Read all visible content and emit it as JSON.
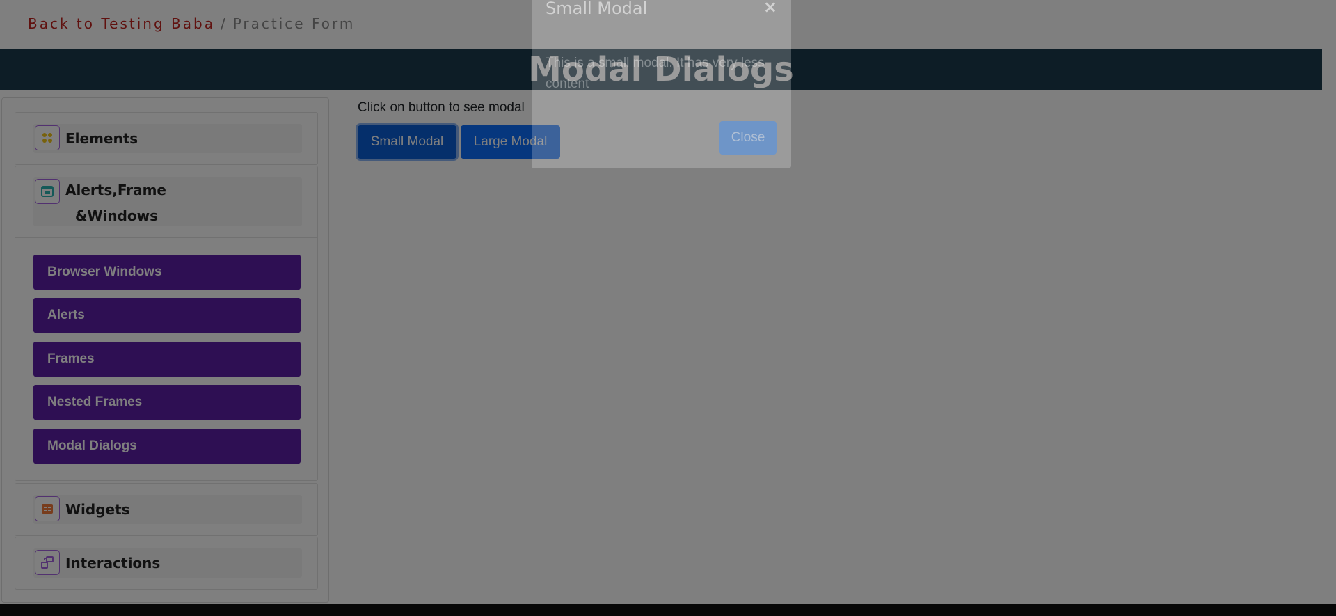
{
  "breadcrumb": {
    "link": "Back to Testing Baba",
    "separator": "/",
    "current": "Practice Form"
  },
  "banner": {
    "title": "Modal Dialogs"
  },
  "sidebar": {
    "groups": [
      {
        "label": "Elements",
        "icon": "grid-dots-icon"
      },
      {
        "label_line1": "Alerts,Frame",
        "label_line2": "&Windows",
        "icon": "window-icon"
      },
      {
        "label": "Widgets",
        "icon": "widget-icon"
      },
      {
        "label": "Interactions",
        "icon": "interaction-icon"
      }
    ],
    "sub_items": [
      {
        "label": "Browser Windows"
      },
      {
        "label": "Alerts"
      },
      {
        "label": "Frames"
      },
      {
        "label": "Nested Frames"
      },
      {
        "label": "Modal Dialogs"
      }
    ]
  },
  "main": {
    "instruction": "Click on button to see modal",
    "small_modal_button": "Small Modal",
    "large_modal_button": "Large Modal"
  },
  "modal": {
    "title": "Small Modal",
    "close_x": "×",
    "body": "This is a small modal. It has very less content",
    "close_button": "Close"
  },
  "colors": {
    "accent_purple": "#5d1fa6",
    "banner_bg": "#1b3a4d",
    "primary_button": "#0d6efd",
    "breadcrumb_link": "#c0231e"
  }
}
